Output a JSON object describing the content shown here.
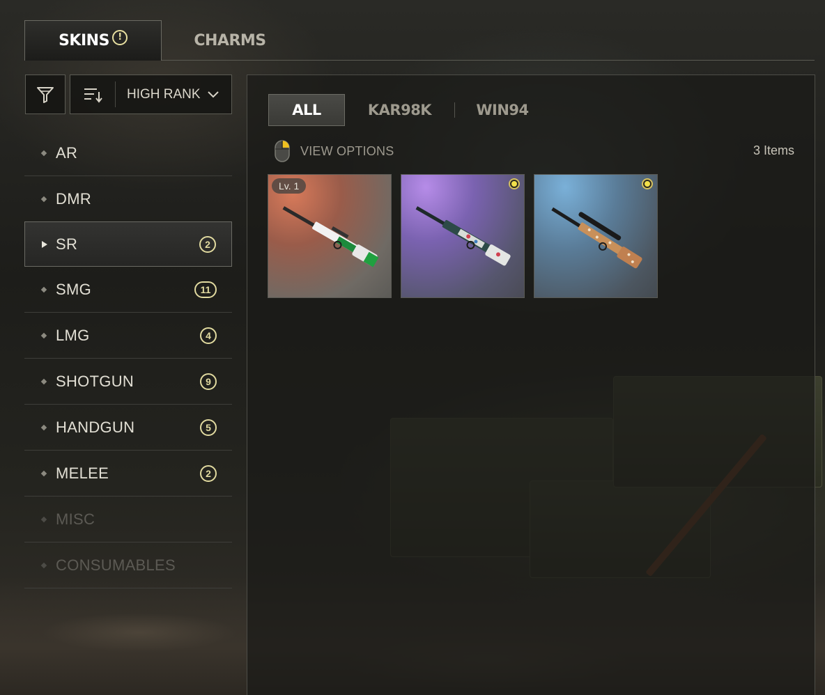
{
  "top_tabs": [
    {
      "label": "SKINS",
      "active": true,
      "alert": true
    },
    {
      "label": "CHARMS",
      "active": false
    }
  ],
  "sort": {
    "label": "HIGH RANK"
  },
  "categories": [
    {
      "label": "AR",
      "count": null,
      "state": "normal"
    },
    {
      "label": "DMR",
      "count": null,
      "state": "normal"
    },
    {
      "label": "SR",
      "count": "2",
      "state": "active"
    },
    {
      "label": "SMG",
      "count": "11",
      "state": "normal"
    },
    {
      "label": "LMG",
      "count": "4",
      "state": "normal"
    },
    {
      "label": "SHOTGUN",
      "count": "9",
      "state": "normal"
    },
    {
      "label": "HANDGUN",
      "count": "5",
      "state": "normal"
    },
    {
      "label": "MELEE",
      "count": "2",
      "state": "normal"
    },
    {
      "label": "MISC",
      "count": null,
      "state": "disabled"
    },
    {
      "label": "CONSUMABLES",
      "count": null,
      "state": "disabled"
    }
  ],
  "sub_tabs": [
    {
      "label": "ALL",
      "active": true
    },
    {
      "label": "KAR98K",
      "active": false
    },
    {
      "label": "WIN94",
      "active": false
    }
  ],
  "view_options": {
    "label": "VIEW OPTIONS",
    "icon": "mouse-icon"
  },
  "item_count": "3 Items",
  "items": [
    {
      "level": "Lv. 1",
      "rarity": false,
      "gun": "kar98k-green-white"
    },
    {
      "level": null,
      "rarity": true,
      "gun": "kar98k-teal-floral"
    },
    {
      "level": null,
      "rarity": true,
      "gun": "win94-scoped-patterned"
    }
  ],
  "colors": {
    "accent_badge": "#e2dba0",
    "rarity_yellow": "#f2e04a",
    "panel_border": "#4e4e48"
  }
}
